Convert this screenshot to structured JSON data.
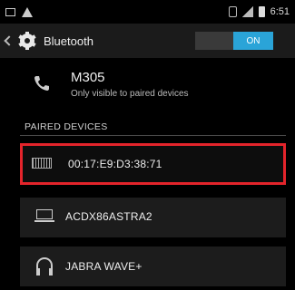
{
  "status_bar": {
    "time": "6:51"
  },
  "action_bar": {
    "title": "Bluetooth",
    "toggle_label": "ON"
  },
  "this_device": {
    "name": "M305",
    "subtitle": "Only visible to paired devices"
  },
  "paired_devices": {
    "header": "PAIRED DEVICES",
    "items": [
      {
        "label": "00:17:E9:D3:38:71",
        "icon": "keyboard-icon",
        "selected": true
      },
      {
        "label": "ACDX86ASTRA2",
        "icon": "laptop-icon",
        "selected": false
      },
      {
        "label": "JABRA WAVE+",
        "icon": "headphones-icon",
        "selected": false
      }
    ]
  },
  "colors": {
    "toggle_on": "#2aa4d8",
    "highlight": "#e3242b"
  }
}
